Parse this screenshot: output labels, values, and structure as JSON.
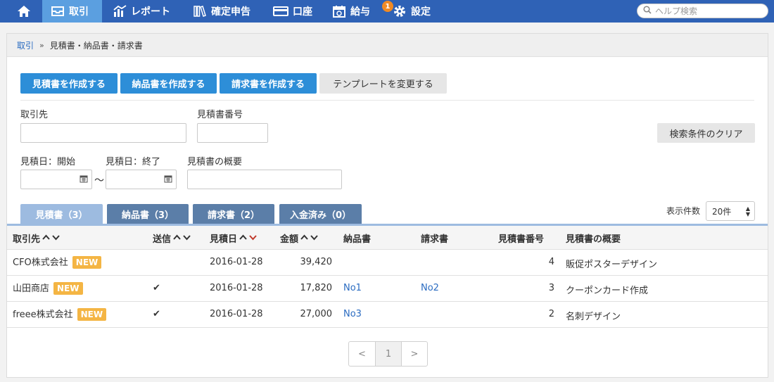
{
  "nav": {
    "items": [
      {
        "label": ""
      },
      {
        "label": "取引"
      },
      {
        "label": "レポート"
      },
      {
        "label": "確定申告"
      },
      {
        "label": "口座"
      },
      {
        "label": "給与"
      },
      {
        "label": "設定"
      }
    ],
    "settings_badge": "1",
    "help_placeholder": "ヘルプ検索"
  },
  "breadcrumb": {
    "parent": "取引",
    "separator": "»",
    "current": "見積書・納品書・請求書"
  },
  "actions": {
    "create_estimate": "見積書を作成する",
    "create_delivery": "納品書を作成する",
    "create_invoice": "請求書を作成する",
    "change_template": "テンプレートを変更する"
  },
  "filters": {
    "partner_label": "取引先",
    "estimate_no_label": "見積書番号",
    "clear_label": "検索条件のクリア",
    "date_start_label": "見積日：開始",
    "date_end_label": "見積日：終了",
    "summary_label": "見積書の概要",
    "tilde": "〜"
  },
  "tabs": [
    {
      "label": "見積書（3）",
      "active": true
    },
    {
      "label": "納品書（3）",
      "active": false
    },
    {
      "label": "請求書（2）",
      "active": false
    },
    {
      "label": "入金済み（0）",
      "active": false
    }
  ],
  "per_page": {
    "label": "表示件数",
    "value": "20件"
  },
  "table": {
    "columns": [
      "取引先",
      "送信",
      "見積日",
      "金額",
      "納品書",
      "請求書",
      "見積書番号",
      "見積書の概要"
    ],
    "rows": [
      {
        "partner": "CFO株式会社",
        "new": "NEW",
        "sent": "",
        "date": "2016-01-28",
        "amount": "39,420",
        "delivery": "",
        "invoice": "",
        "number": "4",
        "summary": "販促ポスターデザイン"
      },
      {
        "partner": "山田商店",
        "new": "NEW",
        "sent": "✔",
        "date": "2016-01-28",
        "amount": "17,820",
        "delivery": "No1",
        "invoice": "No2",
        "number": "3",
        "summary": "クーポンカード作成"
      },
      {
        "partner": "freee株式会社",
        "new": "NEW",
        "sent": "✔",
        "date": "2016-01-28",
        "amount": "27,000",
        "delivery": "No3",
        "invoice": "",
        "number": "2",
        "summary": "名刺デザイン"
      }
    ]
  },
  "pager": {
    "prev": "<",
    "current": "1",
    "next": ">"
  },
  "colors": {
    "nav": "#2f62b6",
    "nav_active": "#5b9fe0",
    "primary": "#2d8ed8",
    "new_badge": "#f4b544",
    "sort_active": "#c0392b"
  }
}
